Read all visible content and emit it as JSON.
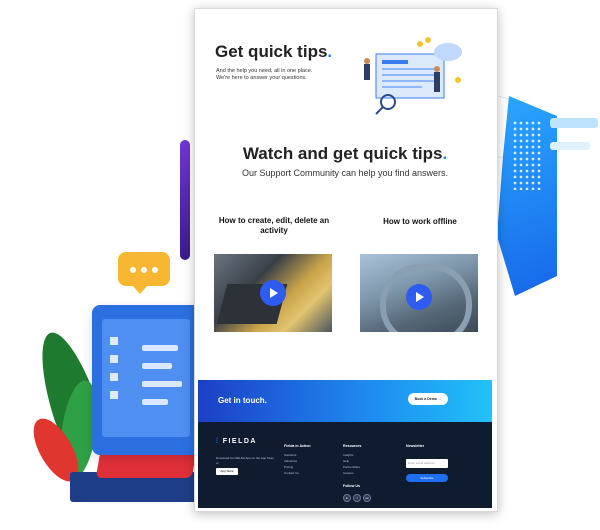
{
  "hero": {
    "title": "Get quick tips",
    "title_dot": ".",
    "subtitle": "And the help you need, all in one place. We're here to answer your questions."
  },
  "section": {
    "title": "Watch and get quick tips",
    "title_dot": ".",
    "subtitle": "Our Support Community can help you find answers."
  },
  "videos": [
    {
      "title": "How to create, edit, delete an activity"
    },
    {
      "title": "How to work offline"
    }
  ],
  "cta": {
    "text": "Get in touch.",
    "button": "Book a Demo →"
  },
  "footer": {
    "logo": "FIELDA",
    "blurb": "Download for FIELDA App on the App Store or",
    "appstore": "App Store",
    "columns": [
      {
        "heading": "Fielda in Action",
        "items": [
          "Solutions",
          "Industries",
          "Pricing",
          "Contact Us"
        ]
      },
      {
        "heading": "Resources",
        "items": [
          "Insights",
          "Help",
          "Partnerships",
          "Careers"
        ]
      },
      {
        "heading": "Newsletter",
        "input_placeholder": "Enter email address",
        "button": "Subscribe"
      }
    ],
    "follow": "Follow Us",
    "social": [
      "in",
      "f",
      "tw"
    ]
  },
  "colors": {
    "accent": "#2a7cf6",
    "cta_start": "#1c3fc6",
    "cta_end": "#22c2f7",
    "footer_bg": "#0f1b2e",
    "play": "#2e5cf0"
  },
  "icons": [
    "play-icon",
    "chat-bubble-icon",
    "monitor-illustration",
    "plant-illustration"
  ]
}
